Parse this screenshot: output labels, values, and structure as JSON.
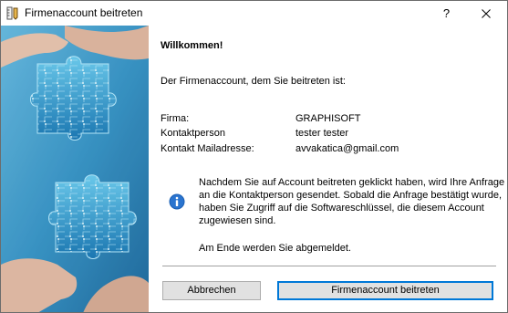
{
  "window": {
    "title": "Firmenaccount beitreten",
    "help_label": "?",
    "close_icon": "close-icon",
    "app_icon": "ruler-pencil-icon"
  },
  "main": {
    "welcome": "Willkommen!",
    "intro": "Der Firmenaccount, dem Sie beitreten ist:",
    "details": [
      {
        "label": "Firma:",
        "value": "GRAPHISOFT"
      },
      {
        "label": "Kontaktperson",
        "value": "tester tester"
      },
      {
        "label": "Kontakt Mailadresse:",
        "value": "avvakatica@gmail.com"
      }
    ],
    "info_icon": "info-icon",
    "info_text": "Nachdem Sie auf Account beitreten geklickt haben, wird Ihre Anfrage an die Kontaktperson gesendet. Sobald die Anfrage bestätigt wurde, haben Sie Zugriff auf die Softwareschlüssel, die diesem Account zugewiesen sind.",
    "logout_note": "Am Ende werden Sie abgemeldet."
  },
  "buttons": {
    "cancel": "Abbrechen",
    "join": "Firmenaccount beitreten"
  },
  "colors": {
    "accent": "#0078d7",
    "info_icon": "#1a5fb4",
    "image_bg": "#1e84b8"
  }
}
